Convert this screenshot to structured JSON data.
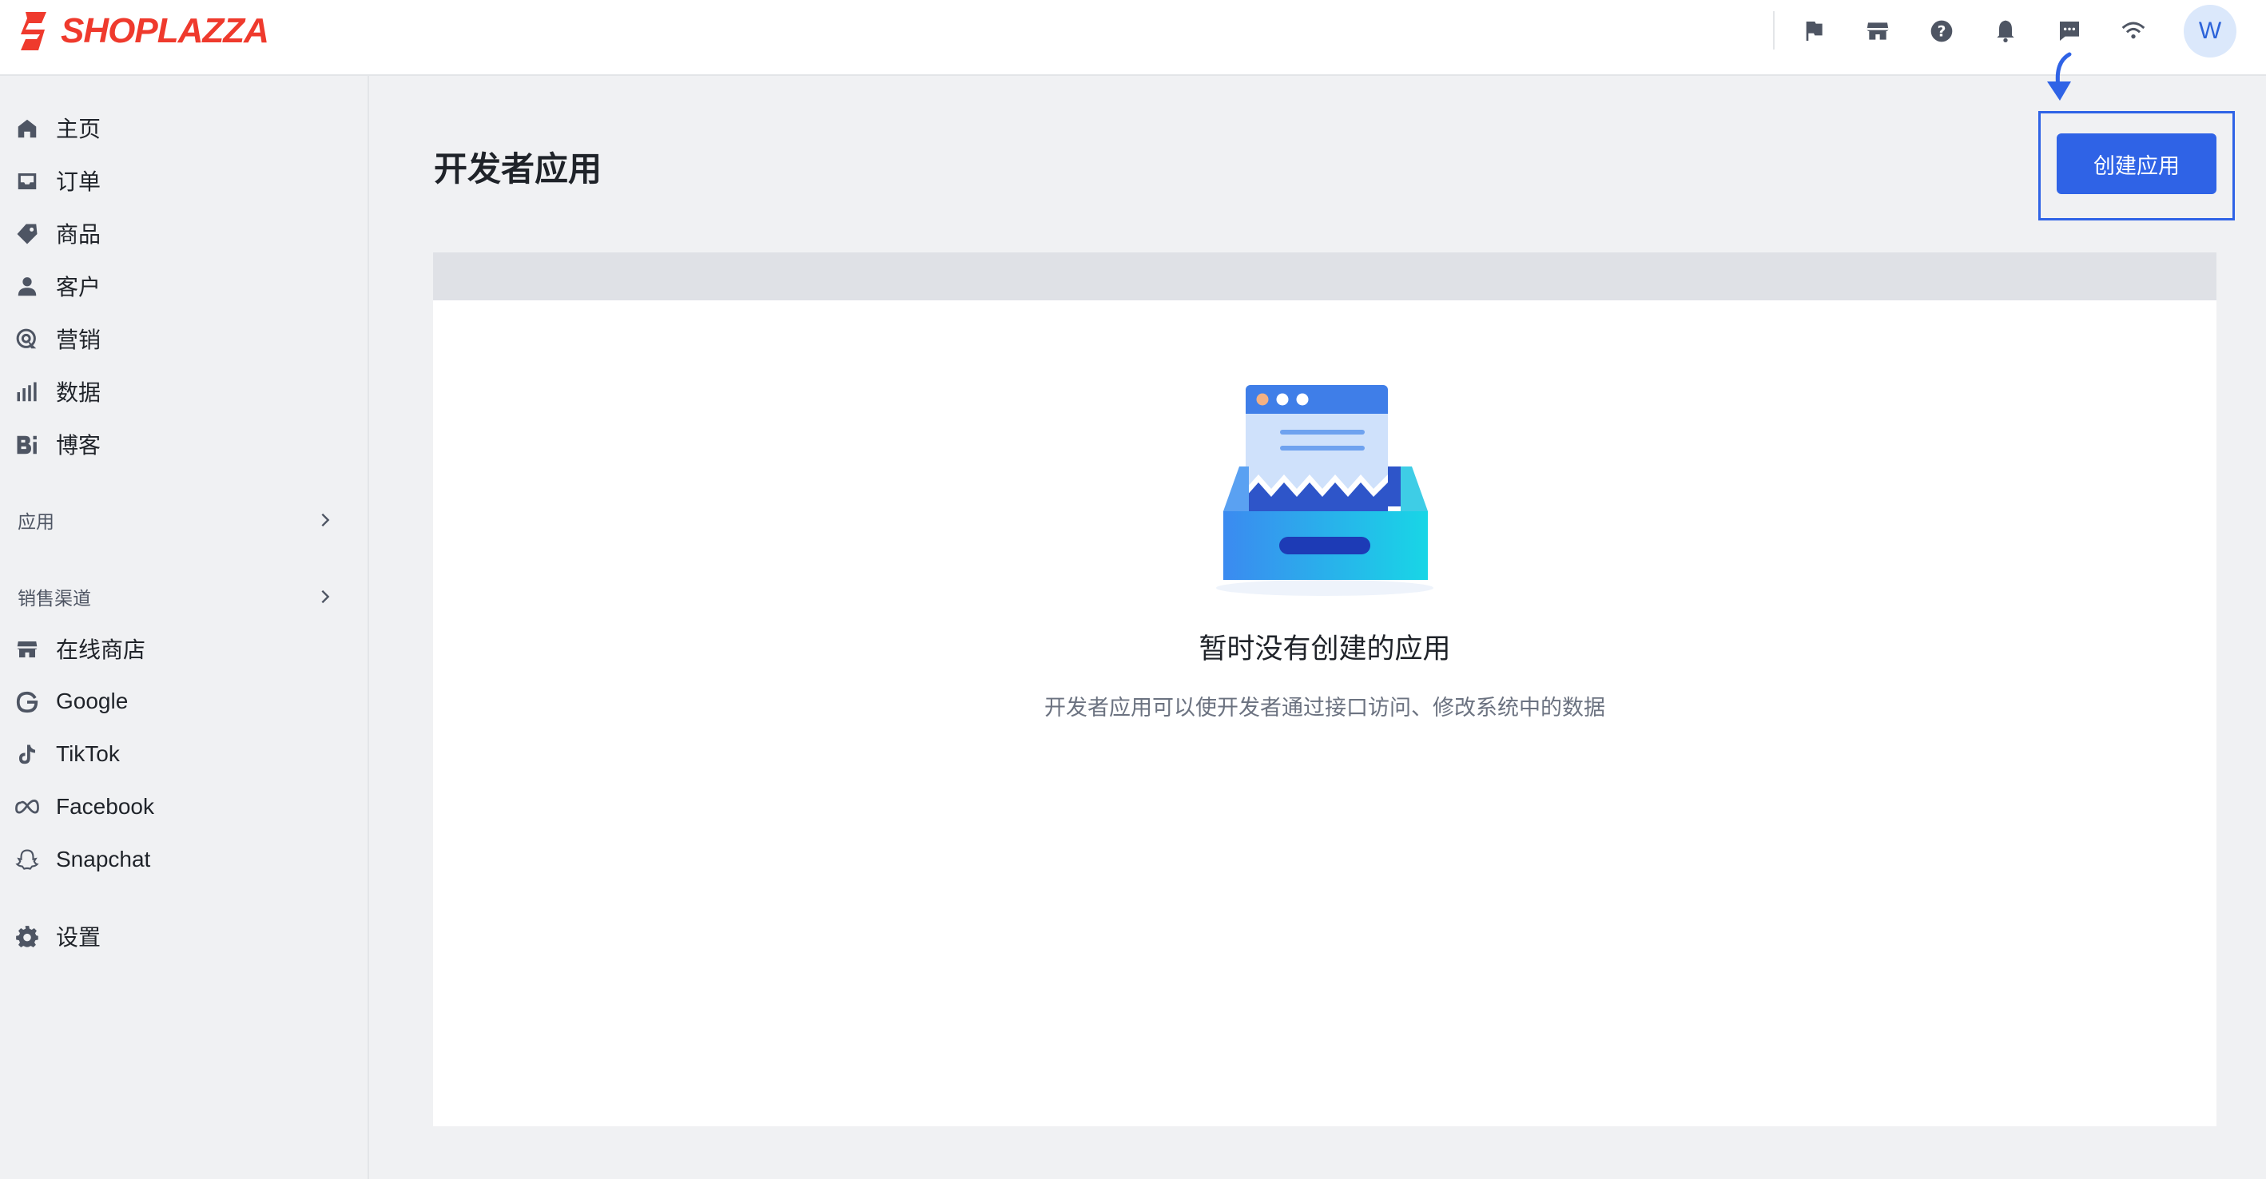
{
  "brand": {
    "name": "SHOPLAZZA",
    "color": "#ef3a2d"
  },
  "topbar": {
    "icons": [
      "flag-icon",
      "store-icon",
      "help-icon",
      "bell-icon",
      "message-icon",
      "wifi-icon"
    ],
    "avatar_initial": "W"
  },
  "sidebar": {
    "main_items": [
      {
        "label": "主页",
        "icon": "home-icon"
      },
      {
        "label": "订单",
        "icon": "inbox-icon"
      },
      {
        "label": "商品",
        "icon": "tag-icon"
      },
      {
        "label": "客户",
        "icon": "person-icon"
      },
      {
        "label": "营销",
        "icon": "marketing-icon"
      },
      {
        "label": "数据",
        "icon": "bar-chart-icon"
      },
      {
        "label": "博客",
        "icon": "blog-icon"
      }
    ],
    "apps_section": {
      "label": "应用"
    },
    "channels_section": {
      "label": "销售渠道"
    },
    "channel_items": [
      {
        "label": "在线商店",
        "icon": "store-icon"
      },
      {
        "label": "Google",
        "icon": "google-icon"
      },
      {
        "label": "TikTok",
        "icon": "tiktok-icon"
      },
      {
        "label": "Facebook",
        "icon": "meta-icon"
      },
      {
        "label": "Snapchat",
        "icon": "snapchat-icon"
      }
    ],
    "settings": {
      "label": "设置",
      "icon": "gear-icon"
    }
  },
  "main": {
    "page_title": "开发者应用",
    "create_button_label": "创建应用",
    "empty_state": {
      "title": "暂时没有创建的应用",
      "subtitle": "开发者应用可以使开发者通过接口访问、修改系统中的数据"
    }
  },
  "colors": {
    "accent": "#2f63e6",
    "background": "#f0f1f3",
    "card": "#ffffff",
    "card_header": "#dfe1e6"
  }
}
